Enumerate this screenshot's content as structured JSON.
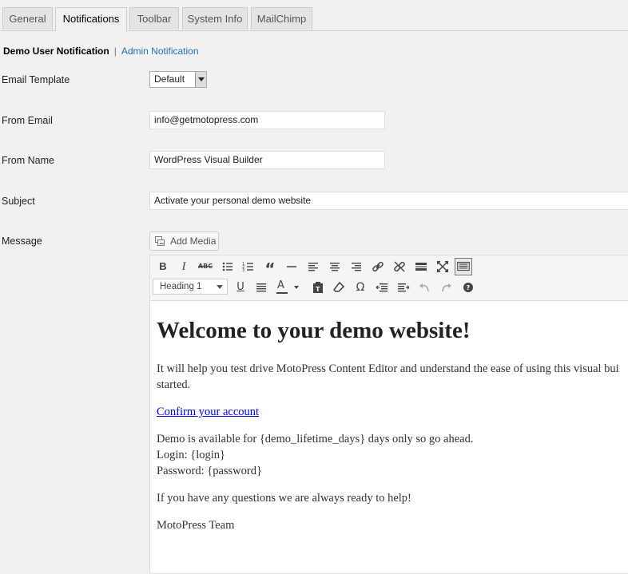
{
  "tabs": [
    {
      "label": "General"
    },
    {
      "label": "Notifications"
    },
    {
      "label": "Toolbar"
    },
    {
      "label": "System Info"
    },
    {
      "label": "MailChimp"
    }
  ],
  "subnav": {
    "current": "Demo User Notification",
    "separator": "|",
    "other": "Admin Notification"
  },
  "form": {
    "email_template_label": "Email Template",
    "email_template_value": "Default",
    "from_email_label": "From Email",
    "from_email_value": "info@getmotopress.com",
    "from_name_label": "From Name",
    "from_name_value": "WordPress Visual Builder",
    "subject_label": "Subject",
    "subject_value": "Activate your personal demo website",
    "message_label": "Message",
    "add_media_label": "Add Media"
  },
  "editor": {
    "format_select": "Heading 1",
    "heading": "Welcome to your demo website!",
    "para1_line1": "It will help you test drive MotoPress Content Editor and understand the ease of using this visual bui",
    "para1_line2": "started.",
    "confirm_link": "Confirm your account",
    "demo_line": "Demo is available for {demo_lifetime_days} days only so go ahead.",
    "login_line": "Login: {login}",
    "password_line": "Password: {password}",
    "questions_line": "If you have any questions we are always ready to help!",
    "signature": "MotoPress Team"
  },
  "icons": {
    "toolbar_row1": [
      "bold-icon",
      "italic-icon",
      "strikethrough-icon",
      "bullet-list-icon",
      "numbered-list-icon",
      "blockquote-icon",
      "horizontal-rule-icon",
      "align-left-icon",
      "align-center-icon",
      "align-right-icon",
      "link-icon",
      "unlink-icon",
      "read-more-icon",
      "fullscreen-icon",
      "toolbar-toggle-icon"
    ],
    "toolbar_row2": [
      "underline-icon",
      "justify-icon",
      "text-color-icon",
      "paste-text-icon",
      "clear-formatting-icon",
      "special-character-icon",
      "outdent-icon",
      "indent-icon",
      "undo-icon",
      "redo-icon",
      "help-icon"
    ]
  },
  "colors": {
    "link": "#2271b1",
    "content_link": "#0000ee",
    "background": "#f1f1f1"
  }
}
